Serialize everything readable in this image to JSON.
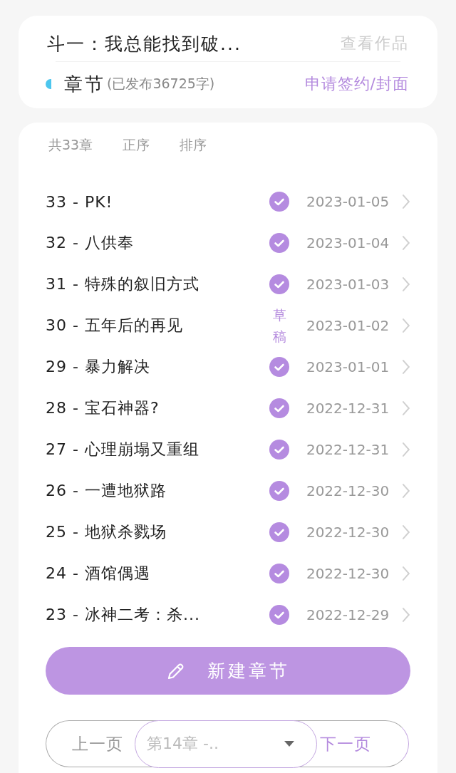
{
  "work": {
    "title": "斗一：我总能找到破...",
    "view_link": "查看作品",
    "section_label": "章节",
    "published_count": "(已发布36725字)",
    "apply_link": "申请签约/封面"
  },
  "toolbar": [
    "共33章",
    "正序",
    "排序"
  ],
  "chapters": [
    {
      "title": "33 - PK!",
      "kind": "published",
      "date": "2023-01-05"
    },
    {
      "title": "32 - 八供奉",
      "kind": "published",
      "date": "2023-01-04"
    },
    {
      "title": "31 - 特殊的叙旧方式",
      "kind": "published",
      "date": "2023-01-03"
    },
    {
      "title": "30 - 五年后的再见",
      "kind": "draft",
      "status_label": "草稿",
      "date": "2023-01-02"
    },
    {
      "title": "29 - 暴力解决",
      "kind": "published",
      "date": "2023-01-01"
    },
    {
      "title": "28 - 宝石神器?",
      "kind": "published",
      "date": "2022-12-31"
    },
    {
      "title": "27 - 心理崩塌又重组",
      "kind": "published",
      "date": "2022-12-31"
    },
    {
      "title": "26 - 一遭地狱路",
      "kind": "published",
      "date": "2022-12-30"
    },
    {
      "title": "25 - 地狱杀戮场",
      "kind": "published",
      "date": "2022-12-30"
    },
    {
      "title": "24 - 酒馆偶遇",
      "kind": "published",
      "date": "2022-12-30"
    },
    {
      "title": "23 - 冰神二考：杀...",
      "kind": "published",
      "date": "2022-12-29"
    }
  ],
  "new_chapter_button": "新建章节",
  "pager": {
    "prev": "上一页",
    "select": "第14章 -..",
    "next": "下一页"
  }
}
